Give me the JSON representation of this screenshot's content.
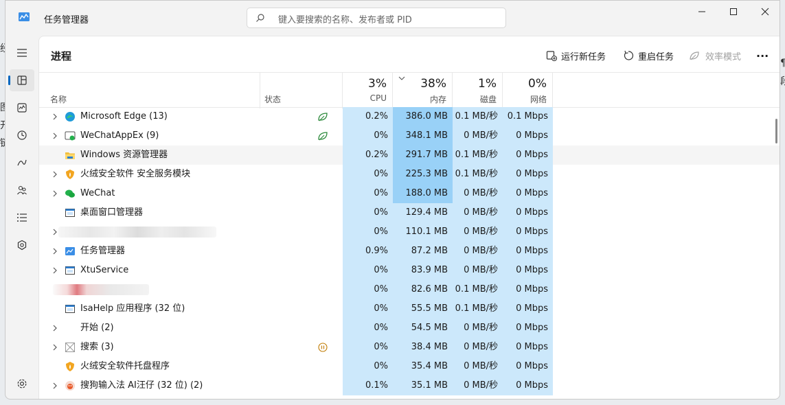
{
  "background": {
    "left_chars": [
      "经",
      "图",
      "开",
      "链"
    ],
    "right_chars": [
      "¶",
      "段"
    ]
  },
  "window": {
    "title": "任务管理器",
    "search_placeholder": "键入要搜索的名称、发布者或 PID",
    "controls": {
      "minimize": "—",
      "maximize": "☐",
      "close": "✕"
    }
  },
  "sidebar": {
    "items": [
      {
        "icon": "menu-icon",
        "active": false
      },
      {
        "icon": "processes-icon",
        "active": true
      },
      {
        "icon": "performance-icon",
        "active": false
      },
      {
        "icon": "app-history-icon",
        "active": false
      },
      {
        "icon": "startup-icon",
        "active": false
      },
      {
        "icon": "users-icon",
        "active": false
      },
      {
        "icon": "details-icon",
        "active": false
      },
      {
        "icon": "services-icon",
        "active": false
      }
    ],
    "settings_icon": "settings-icon"
  },
  "page": {
    "title": "进程",
    "toolbar": {
      "run_new_task": "运行新任务",
      "restart_task": "重启任务",
      "efficiency_mode": "效率模式",
      "more": "···"
    }
  },
  "columns": {
    "name": "名称",
    "status": "状态",
    "cpu": {
      "pct": "3%",
      "label": "CPU"
    },
    "memory": {
      "pct": "38%",
      "label": "内存"
    },
    "disk": {
      "pct": "1%",
      "label": "磁盘"
    },
    "network": {
      "pct": "0%",
      "label": "网络"
    }
  },
  "colors": {
    "cpu_bg": "#cce8fb",
    "mem_bg": "#cce8fb",
    "mem_high": "#99d1f7",
    "accent": "#0067c0"
  },
  "processes": [
    {
      "name": "Microsoft Edge (13)",
      "icon": "edge-icon",
      "expand": true,
      "status": "leaf",
      "cpu": "0.2%",
      "mem": "386.0 MB",
      "mem_high": true,
      "disk": "0.1 MB/秒",
      "net": "0.1 Mbps"
    },
    {
      "name": "WeChatAppEx (9)",
      "icon": "wechat-appex-icon",
      "expand": true,
      "status": "leaf",
      "cpu": "0%",
      "mem": "348.1 MB",
      "mem_high": true,
      "disk": "0 MB/秒",
      "net": "0 Mbps"
    },
    {
      "name": "Windows 资源管理器",
      "icon": "folder-icon",
      "expand": false,
      "status": "",
      "cpu": "0.2%",
      "mem": "291.7 MB",
      "mem_high": true,
      "disk": "0.1 MB/秒",
      "net": "0 Mbps",
      "highlight": true
    },
    {
      "name": "火绒安全软件 安全服务模块",
      "icon": "huorong-icon",
      "expand": true,
      "status": "",
      "cpu": "0%",
      "mem": "225.3 MB",
      "mem_high": true,
      "disk": "0.1 MB/秒",
      "net": "0 Mbps"
    },
    {
      "name": "WeChat",
      "icon": "wechat-icon",
      "expand": true,
      "status": "",
      "cpu": "0%",
      "mem": "188.0 MB",
      "mem_high": true,
      "disk": "0 MB/秒",
      "net": "0 Mbps"
    },
    {
      "name": "桌面窗口管理器",
      "icon": "window-icon",
      "expand": false,
      "status": "",
      "cpu": "0%",
      "mem": "129.4 MB",
      "mem_high": false,
      "disk": "0 MB/秒",
      "net": "0 Mbps"
    },
    {
      "name": "",
      "icon": "blurred-icon",
      "expand": true,
      "status": "",
      "blurred": "gray",
      "cpu": "0%",
      "mem": "110.1 MB",
      "mem_high": false,
      "disk": "0 MB/秒",
      "net": "0 Mbps"
    },
    {
      "name": "任务管理器",
      "icon": "task-manager-icon",
      "expand": true,
      "status": "",
      "cpu": "0.9%",
      "mem": "87.2 MB",
      "mem_high": false,
      "disk": "0 MB/秒",
      "net": "0 Mbps"
    },
    {
      "name": "XtuService",
      "icon": "window-icon",
      "expand": true,
      "status": "",
      "cpu": "0%",
      "mem": "83.9 MB",
      "mem_high": false,
      "disk": "0 MB/秒",
      "net": "0 Mbps"
    },
    {
      "name": "",
      "icon": "blurred-icon",
      "expand": false,
      "status": "",
      "blurred": "red",
      "cpu": "0%",
      "mem": "82.6 MB",
      "mem_high": false,
      "disk": "0.1 MB/秒",
      "net": "0 Mbps"
    },
    {
      "name": "IsaHelp 应用程序 (32 位)",
      "icon": "window-icon",
      "expand": false,
      "status": "",
      "cpu": "0%",
      "mem": "55.5 MB",
      "mem_high": false,
      "disk": "0.1 MB/秒",
      "net": "0 Mbps"
    },
    {
      "name": "开始 (2)",
      "icon": "none",
      "expand": true,
      "status": "",
      "cpu": "0%",
      "mem": "54.5 MB",
      "mem_high": false,
      "disk": "0 MB/秒",
      "net": "0 Mbps"
    },
    {
      "name": "搜索 (3)",
      "icon": "search-app-icon",
      "expand": true,
      "status": "pause",
      "cpu": "0%",
      "mem": "38.4 MB",
      "mem_high": false,
      "disk": "0 MB/秒",
      "net": "0 Mbps"
    },
    {
      "name": "火绒安全软件托盘程序",
      "icon": "huorong-icon",
      "expand": false,
      "status": "",
      "cpu": "0%",
      "mem": "35.4 MB",
      "mem_high": false,
      "disk": "0 MB/秒",
      "net": "0 Mbps"
    },
    {
      "name": "搜狗输入法 AI汪仔 (32 位) (2)",
      "icon": "sogou-icon",
      "expand": true,
      "status": "",
      "cpu": "0.1%",
      "mem": "35.1 MB",
      "mem_high": false,
      "disk": "0 MB/秒",
      "net": "0 Mbps"
    }
  ]
}
